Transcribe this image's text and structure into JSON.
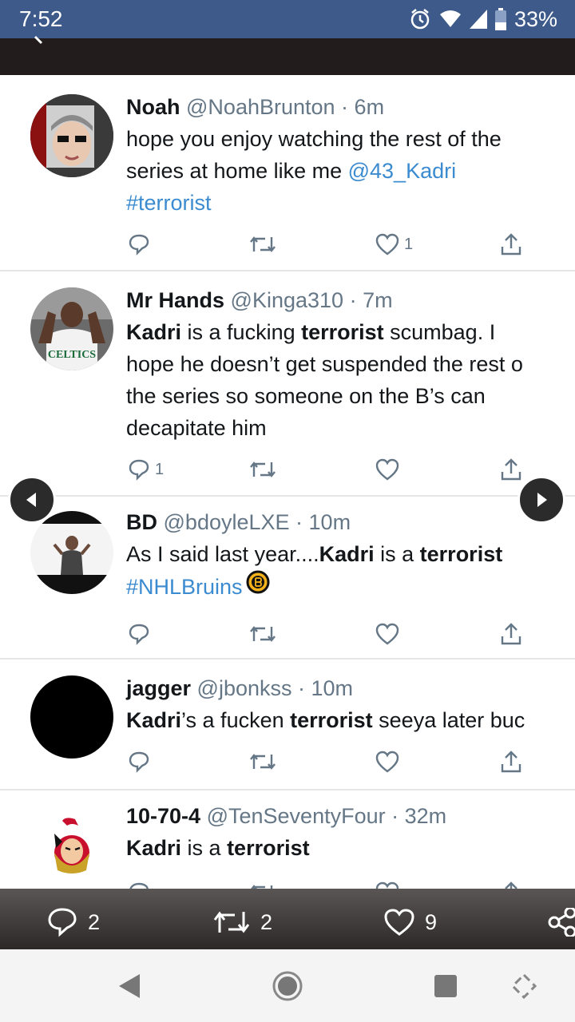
{
  "status_bar": {
    "time": "7:52",
    "battery": "33%"
  },
  "tweets": [
    {
      "name": "Noah",
      "handle": "@NoahBrunton",
      "time": "6m",
      "text_lines": [
        "hope you enjoy watching the rest of the",
        "series at home like me "
      ],
      "mention": "@43_Kadri",
      "hashtag": "#terrorist",
      "likes": "1",
      "replies": ""
    },
    {
      "name": "Mr Hands",
      "handle": "@Kinga310",
      "time": "7m",
      "line1_a": "Kadri",
      "line1_b": " is a fucking ",
      "line1_c": "terrorist",
      "line1_d": " scumbag. I",
      "line2": "hope he doesn’t get suspended the rest o",
      "line3": "the series so someone on the B’s can",
      "line4": "decapitate him",
      "replies": "1",
      "avatar_text": "CELTICS"
    },
    {
      "name": "BD",
      "handle": "@bdoyleLXE",
      "time": "10m",
      "line1_a": "As I said last year....",
      "line1_b": "Kadri",
      "line1_c": " is a ",
      "line1_d": "terrorist",
      "hashtag": "#NHLBruins"
    },
    {
      "name": "jagger",
      "handle": "@jbonkss",
      "time": "10m",
      "line1_a": "Kadri",
      "line1_b": "’s a fucken ",
      "line1_c": "terrorist",
      "line1_d": " seeya later buc"
    },
    {
      "name": "10-70-4",
      "handle": "@TenSeventyFour",
      "time": "32m",
      "line1_a": "Kadri",
      "line1_b": " is a ",
      "line1_c": "terrorist"
    }
  ],
  "stats": {
    "replies": "2",
    "retweets": "2",
    "likes": "9"
  },
  "colors": {
    "status_bar": "#3d5a8a",
    "app_bar": "#231c1c",
    "link": "#3b8bd0",
    "muted": "#657786"
  }
}
